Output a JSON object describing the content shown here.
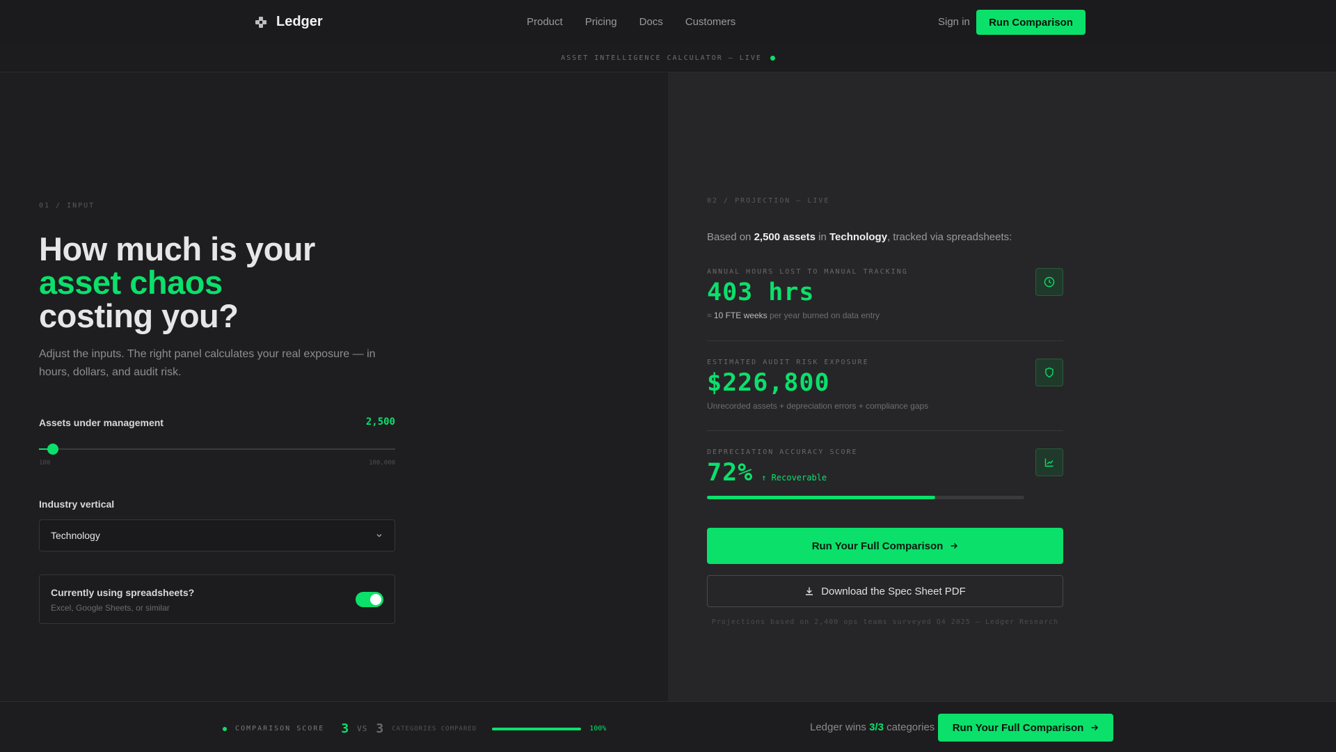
{
  "nav": {
    "brand": "Ledger",
    "links": [
      "Product",
      "Pricing",
      "Docs",
      "Customers"
    ],
    "sign_in": "Sign in",
    "cta": "Run Comparison"
  },
  "ticker": {
    "text": "ASSET INTELLIGENCE CALCULATOR — LIVE"
  },
  "input": {
    "section_label": "01 / INPUT",
    "headline_1": "How much is your",
    "headline_accent": "asset chaos",
    "headline_2": "costing you?",
    "subtitle": "Adjust the inputs. The right panel calculates your real exposure — in hours, dollars, and audit risk.",
    "assets": {
      "label": "Assets under management",
      "value": "2,500",
      "min": "100",
      "max": "100,000",
      "fraction": 0.04
    },
    "industry": {
      "label": "Industry vertical",
      "selected": "Technology"
    },
    "spreadsheet": {
      "title": "Currently using spreadsheets?",
      "hint": "Excel, Google Sheets, or similar",
      "enabled": true
    }
  },
  "projection": {
    "section_label": "02 / PROJECTION — LIVE",
    "summary_pre": "Based on ",
    "summary_assets": "2,500 assets",
    "summary_mid": " in ",
    "summary_industry": "Technology",
    "summary_post": ", tracked via spreadsheets:",
    "hours": {
      "label": "ANNUAL HOURS LOST TO MANUAL TRACKING",
      "value": "403 hrs",
      "note_pre": "≈ ",
      "note_bold": "10 FTE weeks",
      "note_post": " per year burned on data entry",
      "icon": "clock-icon"
    },
    "risk": {
      "label": "ESTIMATED AUDIT RISK EXPOSURE",
      "value": "$226,800",
      "note": "Unrecorded assets + depreciation errors + compliance gaps",
      "icon": "shield-icon"
    },
    "accuracy": {
      "label": "DEPRECIATION ACCURACY SCORE",
      "value": "72%",
      "tag": "↑ Recoverable",
      "progress": 0.72,
      "icon": "chart-icon"
    },
    "cta_main": "Run Your Full Comparison",
    "cta_secondary": "Download the Spec Sheet PDF",
    "footnote": "Projections based on 2,400 ops teams surveyed Q4 2025 — Ledger Research"
  },
  "bottom": {
    "score_label": "COMPARISON SCORE",
    "left_score": "3",
    "vs": "VS",
    "right_score": "3",
    "categories_label": "CATEGORIES COMPARED",
    "percent": "100%",
    "progress": 1.0,
    "wins_pre": "Ledger wins ",
    "wins_value": "3/3",
    "wins_post": " categories",
    "cta": "Run Your Full Comparison"
  },
  "colors": {
    "accent": "#0be06b",
    "bg": "#1c1c1e",
    "panel_right": "#262628"
  }
}
